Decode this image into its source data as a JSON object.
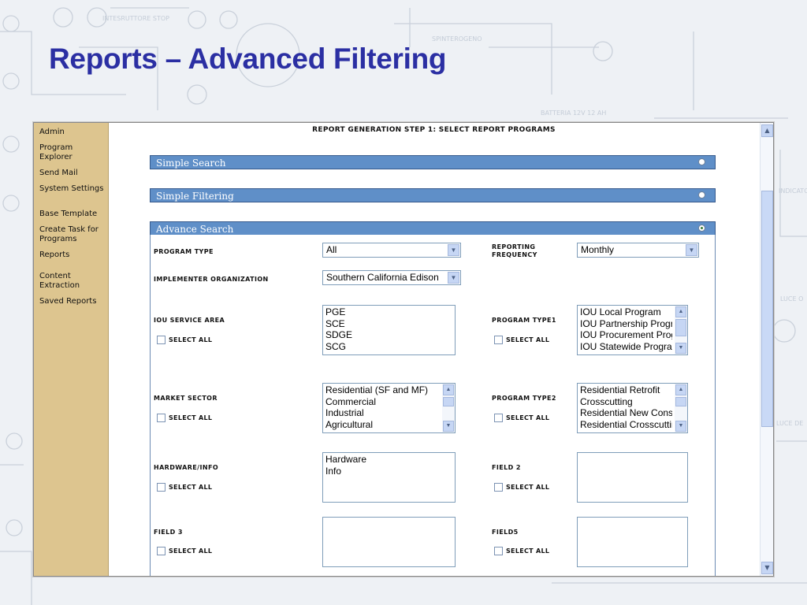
{
  "slide": {
    "title": "Reports – Advanced Filtering"
  },
  "sidebar": {
    "items": [
      {
        "label": "Admin"
      },
      {
        "label": "Program Explorer"
      },
      {
        "label": "Send Mail"
      },
      {
        "label": "System Settings"
      },
      {
        "label": "Base Template"
      },
      {
        "label": "Create Task for Programs"
      },
      {
        "label": "Reports"
      },
      {
        "label": "Content Extraction"
      },
      {
        "label": "Saved Reports"
      }
    ]
  },
  "main": {
    "step_title": "REPORT GENERATION STEP 1: SELECT REPORT PROGRAMS",
    "sections": {
      "simple_search": {
        "label": "Simple Search",
        "selected": false
      },
      "simple_filtering": {
        "label": "Simple Filtering",
        "selected": false
      },
      "advance_search": {
        "label": "Advance Search",
        "selected": true
      }
    }
  },
  "form": {
    "select_all_label": "SELECT ALL",
    "program_type": {
      "label": "PROGRAM TYPE",
      "value": "All"
    },
    "reporting_frequency": {
      "label_line1": "REPORTING",
      "label_line2": "FREQUENCY",
      "value": "Monthly"
    },
    "implementer_org": {
      "label": "IMPLEMENTER ORGANIZATION",
      "value": "Southern California Edison"
    },
    "iou_service_area": {
      "label": "IOU SERVICE AREA",
      "options": [
        "PGE",
        "SCE",
        "SDGE",
        "SCG"
      ]
    },
    "program_type1": {
      "label": "PROGRAM TYPE1",
      "options": [
        "IOU Local Program",
        "IOU Partnership Progr",
        "IOU Procurement Prog",
        "IOU Statewide Progra"
      ]
    },
    "market_sector": {
      "label": "MARKET SECTOR",
      "options": [
        "Residential (SF and MF)",
        "Commercial",
        "Industrial",
        "Agricultural"
      ]
    },
    "program_type2": {
      "label": "PROGRAM TYPE2",
      "options": [
        "Residential Retrofit",
        "Crosscutting",
        "Residential New Cons",
        "Residential Crosscuttin"
      ]
    },
    "hardware_info": {
      "label": "HARDWARE/INFO",
      "options": [
        "Hardware",
        "Info"
      ]
    },
    "field2": {
      "label": "FIELD 2",
      "options": []
    },
    "field3": {
      "label": "FIELD 3",
      "options": []
    },
    "field5": {
      "label": "FIELD5",
      "options": []
    }
  },
  "icons": {
    "dropdown": "chevron-down-icon",
    "scroll_up": "arrow-up-icon",
    "scroll_down": "arrow-down-icon"
  },
  "colors": {
    "title": "#2b2fa3",
    "sidebar": "#ddc58f",
    "section_bar": "#5f8fc8"
  }
}
